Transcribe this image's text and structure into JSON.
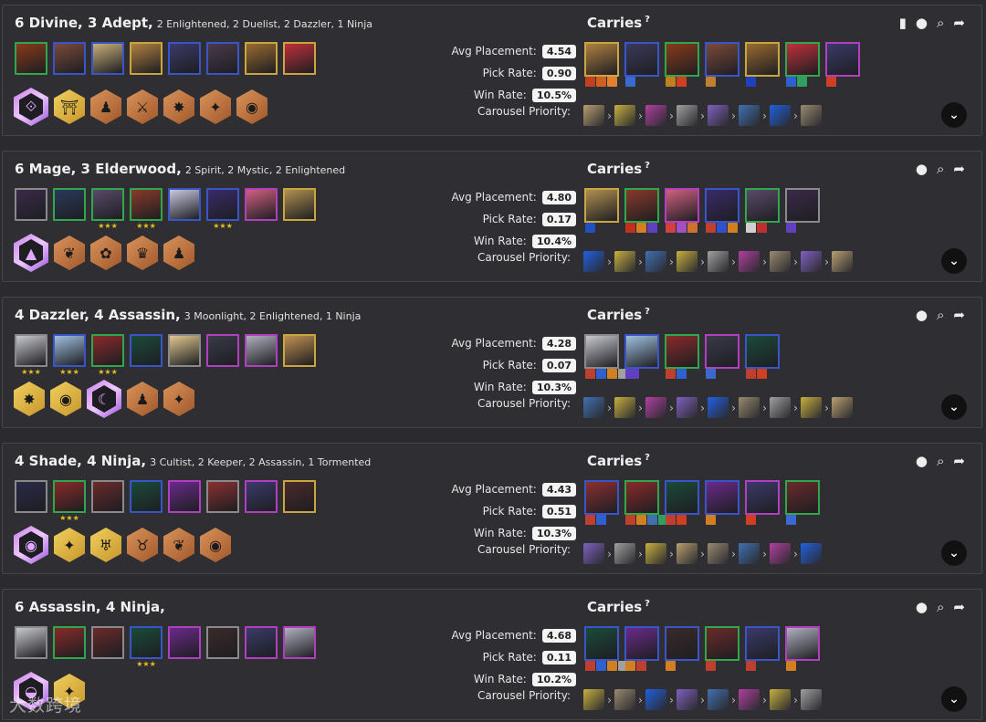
{
  "header_icons": [
    "book-icon",
    "pin-icon",
    "search-icon",
    "share-icon"
  ],
  "labels": {
    "carries": "Carries",
    "help": "?",
    "avg": "Avg Placement:",
    "pick": "Pick Rate:",
    "win": "Win Rate:",
    "carousel": "Carousel Priority:"
  },
  "comps": [
    {
      "title_main": "6 Divine, 3 Adept,",
      "title_sub": "2 Enlightened, 2 Duelist, 2 Dazzler, 1 Ninja",
      "avg": "4.54",
      "pick": "0.90",
      "win": "10.5%",
      "book": true,
      "champs": [
        {
          "b": "green",
          "c": "#8a3a1a",
          "s": ""
        },
        {
          "b": "blue",
          "c": "#7a4a3a",
          "s": ""
        },
        {
          "b": "blue",
          "c": "#c8b07a",
          "s": ""
        },
        {
          "b": "gold",
          "c": "#b08040",
          "s": ""
        },
        {
          "b": "blue",
          "c": "#3a3a6a",
          "s": ""
        },
        {
          "b": "blue",
          "c": "#4a3a4a",
          "s": ""
        },
        {
          "b": "gold",
          "c": "#9a6a30",
          "s": ""
        },
        {
          "b": "gold",
          "c": "#c0303a",
          "s": ""
        }
      ],
      "traits": [
        {
          "t": "chromatic",
          "g": "⟐"
        },
        {
          "t": "gold",
          "g": "⛩"
        },
        {
          "t": "bronze",
          "g": "♟"
        },
        {
          "t": "bronze",
          "g": "⚔"
        },
        {
          "t": "bronze",
          "g": "✸"
        },
        {
          "t": "bronze",
          "g": "✦"
        },
        {
          "t": "bronze",
          "g": "◉"
        }
      ],
      "carries": [
        {
          "b": "gold",
          "c": "#b08040",
          "items": [
            "#c04020",
            "#d06020",
            "#e08030"
          ]
        },
        {
          "b": "blue",
          "c": "#3a3a5a",
          "items": [
            "#3a6ad0"
          ]
        },
        {
          "b": "green",
          "c": "#8a3a1a",
          "items": [
            "#c08020",
            "#d04020"
          ]
        },
        {
          "b": "blue",
          "c": "#7a4a3a",
          "items": [
            "#c08030"
          ]
        },
        {
          "b": "gold",
          "c": "#9a6a30",
          "items": [
            "#2040c0"
          ]
        },
        {
          "b": "green",
          "c": "#c0303a",
          "items": [
            "#3060d0",
            "#30a060"
          ]
        },
        {
          "b": "purple",
          "c": "#3a3a6a",
          "items": [
            "#d04020"
          ]
        }
      ],
      "carousel": [
        "#b8a070",
        "#c8b040",
        "#b040a0",
        "#a0a0a0",
        "#8060c0",
        "#4070b0",
        "#2060e0",
        "#9a8a70"
      ]
    },
    {
      "title_main": "6 Mage, 3 Elderwood,",
      "title_sub": "2 Spirit, 2 Mystic, 2 Enlightened",
      "avg": "4.80",
      "pick": "0.17",
      "win": "10.4%",
      "book": false,
      "champs": [
        {
          "b": "grey",
          "c": "#3a2a4a",
          "s": ""
        },
        {
          "b": "green",
          "c": "#2a3a5a",
          "s": ""
        },
        {
          "b": "green",
          "c": "#5a4a6a",
          "s": "★★★"
        },
        {
          "b": "green",
          "c": "#8a3a2a",
          "s": "★★★"
        },
        {
          "b": "blue",
          "c": "#c8c8e0",
          "s": ""
        },
        {
          "b": "blue",
          "c": "#3a2a6a",
          "s": "★★★"
        },
        {
          "b": "purple",
          "c": "#d06080",
          "s": ""
        },
        {
          "b": "gold",
          "c": "#b09050",
          "s": ""
        }
      ],
      "traits": [
        {
          "t": "chromatic",
          "g": "▲"
        },
        {
          "t": "bronze",
          "g": "❦"
        },
        {
          "t": "bronze",
          "g": "✿"
        },
        {
          "t": "bronze",
          "g": "♛"
        },
        {
          "t": "bronze",
          "g": "♟"
        }
      ],
      "carries": [
        {
          "b": "gold",
          "c": "#b09050",
          "items": [
            "#2050c0"
          ]
        },
        {
          "b": "green",
          "c": "#8a3a2a",
          "items": [
            "#c03020",
            "#d08020",
            "#6040c0"
          ]
        },
        {
          "b": "purple",
          "c": "#d06080",
          "items": [
            "#d04040",
            "#a050c0",
            "#d07030"
          ]
        },
        {
          "b": "blue",
          "c": "#3a2a6a",
          "items": [
            "#c04030",
            "#3050d0",
            "#d08020"
          ]
        },
        {
          "b": "green",
          "c": "#5a4a6a",
          "items": [
            "#d0d0d0",
            "#c03030"
          ]
        },
        {
          "b": "grey",
          "c": "#3a2a4a",
          "items": [
            "#6040c0"
          ]
        }
      ],
      "carousel": [
        "#2060e0",
        "#c8b040",
        "#4070b0",
        "#c8b040",
        "#a0a0a0",
        "#b040a0",
        "#9a8a70",
        "#8060c0",
        "#b8a070"
      ]
    },
    {
      "title_main": "4 Dazzler, 4 Assassin,",
      "title_sub": "3 Moonlight, 2 Enlightened, 1 Ninja",
      "avg": "4.28",
      "pick": "0.07",
      "win": "10.3%",
      "book": false,
      "champs": [
        {
          "b": "grey",
          "c": "#c8c8d0",
          "s": "★★★"
        },
        {
          "b": "blue",
          "c": "#a0c0e0",
          "s": "★★★"
        },
        {
          "b": "green",
          "c": "#8a2a2a",
          "s": "★★★"
        },
        {
          "b": "blue",
          "c": "#1a4a3a",
          "s": ""
        },
        {
          "b": "grey",
          "c": "#e0c890",
          "s": ""
        },
        {
          "b": "purple",
          "c": "#3a3a4a",
          "s": ""
        },
        {
          "b": "purple",
          "c": "#b0b0c0",
          "s": ""
        },
        {
          "b": "gold",
          "c": "#c09050",
          "s": ""
        }
      ],
      "traits": [
        {
          "t": "gold",
          "g": "✸"
        },
        {
          "t": "gold",
          "g": "◉"
        },
        {
          "t": "chromatic",
          "g": "☾"
        },
        {
          "t": "bronze",
          "g": "♟"
        },
        {
          "t": "bronze",
          "g": "✦"
        }
      ],
      "carries": [
        {
          "b": "grey",
          "c": "#c8c8d0",
          "items": [
            "#c04030",
            "#3060d0",
            "#d08020",
            "#a0a0a0",
            "#6040c0"
          ]
        },
        {
          "b": "blue",
          "c": "#a0c0e0",
          "items": [
            "#6040c0"
          ]
        },
        {
          "b": "green",
          "c": "#8a2a2a",
          "items": [
            "#c04030",
            "#3060d0"
          ]
        },
        {
          "b": "purple",
          "c": "#3a3a4a",
          "items": [
            "#3a6ad0"
          ]
        },
        {
          "b": "blue",
          "c": "#1a4a3a",
          "items": [
            "#c04030",
            "#d04020"
          ]
        }
      ],
      "carousel": [
        "#4070b0",
        "#c8b040",
        "#b040a0",
        "#8060c0",
        "#2060e0",
        "#9a8a70",
        "#a0a0a0",
        "#c8b040",
        "#b8a070"
      ]
    },
    {
      "title_main": "4 Shade, 4 Ninja,",
      "title_sub": "3 Cultist, 2 Keeper, 2 Assassin, 1 Tormented",
      "avg": "4.43",
      "pick": "0.51",
      "win": "10.3%",
      "book": false,
      "champs": [
        {
          "b": "grey",
          "c": "#2a2a4a",
          "s": ""
        },
        {
          "b": "green",
          "c": "#8a2a2a",
          "s": "★★★"
        },
        {
          "b": "grey",
          "c": "#6a2a2a",
          "s": ""
        },
        {
          "b": "blue",
          "c": "#1a4a3a",
          "s": ""
        },
        {
          "b": "purple",
          "c": "#6a2a8a",
          "s": ""
        },
        {
          "b": "grey",
          "c": "#8a3030",
          "s": ""
        },
        {
          "b": "purple",
          "c": "#3a3a6a",
          "s": ""
        },
        {
          "b": "gold",
          "c": "#4a2a2a",
          "s": ""
        }
      ],
      "traits": [
        {
          "t": "chromatic",
          "g": "◉"
        },
        {
          "t": "gold",
          "g": "✦"
        },
        {
          "t": "gold",
          "g": "♅"
        },
        {
          "t": "bronze",
          "g": "♉"
        },
        {
          "t": "bronze",
          "g": "❦"
        },
        {
          "t": "bronze",
          "g": "◉"
        }
      ],
      "carries": [
        {
          "b": "blue",
          "c": "#8a3030",
          "items": [
            "#c04030",
            "#3060d0"
          ]
        },
        {
          "b": "green",
          "c": "#8a2a2a",
          "items": [
            "#c04030",
            "#d08020",
            "#4070b0",
            "#30a060"
          ]
        },
        {
          "b": "blue",
          "c": "#1a4a3a",
          "items": [
            "#c04030",
            "#d04020"
          ]
        },
        {
          "b": "blue",
          "c": "#6a2a8a",
          "items": [
            "#d08020"
          ]
        },
        {
          "b": "purple",
          "c": "#3a3a6a",
          "items": [
            "#d04020"
          ]
        },
        {
          "b": "green",
          "c": "#6a2a2a",
          "items": [
            "#3a6ad0"
          ]
        }
      ],
      "carousel": [
        "#8060c0",
        "#a0a0a0",
        "#c8b040",
        "#b8a070",
        "#9a8a70",
        "#4070b0",
        "#b040a0",
        "#2060e0"
      ]
    },
    {
      "title_main": "6 Assassin, 4 Ninja,",
      "title_sub": "",
      "avg": "4.68",
      "pick": "0.11",
      "win": "10.2%",
      "book": false,
      "champs": [
        {
          "b": "grey",
          "c": "#c8c8d0",
          "s": ""
        },
        {
          "b": "green",
          "c": "#8a2a2a",
          "s": ""
        },
        {
          "b": "grey",
          "c": "#6a2a2a",
          "s": ""
        },
        {
          "b": "blue",
          "c": "#1a4a3a",
          "s": "★★★"
        },
        {
          "b": "purple",
          "c": "#6a2a8a",
          "s": ""
        },
        {
          "b": "grey",
          "c": "#3a2a2a",
          "s": ""
        },
        {
          "b": "purple",
          "c": "#3a3a6a",
          "s": ""
        },
        {
          "b": "purple",
          "c": "#b0b0c0",
          "s": ""
        }
      ],
      "traits": [
        {
          "t": "chromatic",
          "g": "◒"
        },
        {
          "t": "gold",
          "g": "✦"
        }
      ],
      "carries": [
        {
          "b": "blue",
          "c": "#1a4a3a",
          "items": [
            "#c04030",
            "#3060d0",
            "#d08020",
            "#a0a0a0"
          ]
        },
        {
          "b": "blue",
          "c": "#6a2a8a",
          "items": [
            "#d08020",
            "#c04030"
          ]
        },
        {
          "b": "blue",
          "c": "#3a2a2a",
          "items": [
            "#d08020"
          ]
        },
        {
          "b": "green",
          "c": "#6a2a2a",
          "items": [
            "#c04030"
          ]
        },
        {
          "b": "blue",
          "c": "#3a3a6a",
          "items": [
            "#c04030"
          ]
        },
        {
          "b": "purple",
          "c": "#b0b0c0",
          "items": [
            "#d08020"
          ]
        }
      ],
      "carousel": [
        "#c8b040",
        "#9a8a70",
        "#2060e0",
        "#8060c0",
        "#4070b0",
        "#b040a0",
        "#c8b040",
        "#a0a0a0"
      ]
    }
  ],
  "watermark": "大数跨境"
}
